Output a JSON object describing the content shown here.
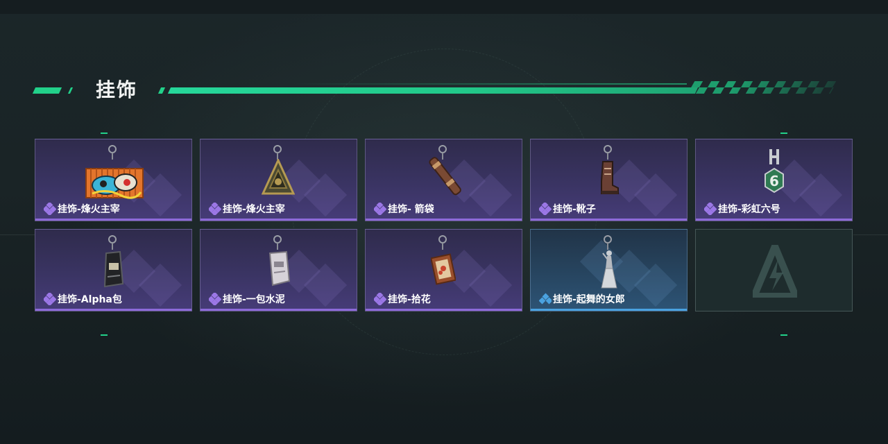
{
  "section": {
    "title": "挂饰"
  },
  "colors": {
    "accent": "#22d18a",
    "epic": "#8d6ad9",
    "rare": "#4aa2e0"
  },
  "cards": [
    {
      "label": "挂饰-烽火主宰",
      "rarity": "epic",
      "icon": "graffiti-container-charm-icon"
    },
    {
      "label": "挂饰-烽火主宰",
      "rarity": "epic",
      "icon": "triangle-pendant-charm-icon"
    },
    {
      "label": "挂饰- 箭袋",
      "rarity": "epic",
      "icon": "quiver-charm-icon"
    },
    {
      "label": "挂饰-靴子",
      "rarity": "epic",
      "icon": "boot-charm-icon"
    },
    {
      "label": "挂饰-彩虹六号",
      "rarity": "epic",
      "icon": "rainbow-six-charm-icon"
    },
    {
      "label": "挂饰-Alpha包",
      "rarity": "epic",
      "icon": "alpha-bag-charm-icon"
    },
    {
      "label": "挂饰-一包水泥",
      "rarity": "epic",
      "icon": "cement-bag-charm-icon"
    },
    {
      "label": "挂饰-拾花",
      "rarity": "epic",
      "icon": "flower-frame-charm-icon"
    },
    {
      "label": "挂饰-起舞的女郎",
      "rarity": "rare",
      "icon": "dancing-lady-charm-icon"
    },
    {
      "label": "",
      "rarity": "empty",
      "icon": "empty-slot-logo-icon"
    }
  ]
}
